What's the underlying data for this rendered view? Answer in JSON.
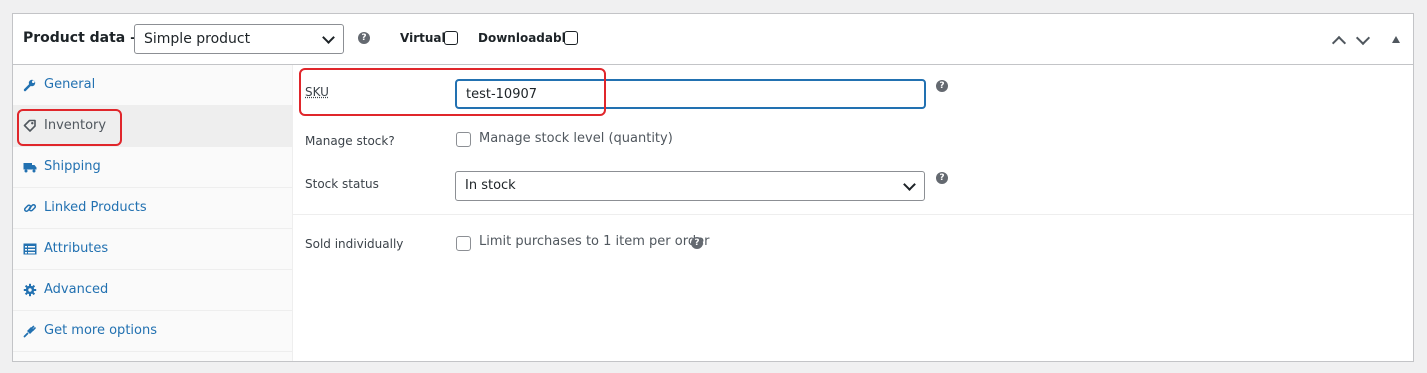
{
  "header": {
    "title": "Product data —",
    "product_type": "Simple product",
    "virtual_label": "Virtual:",
    "downloadable_label": "Downloadable:"
  },
  "sidebar": {
    "items": [
      {
        "label": "General",
        "icon": "wrench-icon"
      },
      {
        "label": "Inventory",
        "icon": "tag-icon",
        "active": true
      },
      {
        "label": "Shipping",
        "icon": "truck-icon"
      },
      {
        "label": "Linked Products",
        "icon": "link-icon"
      },
      {
        "label": "Attributes",
        "icon": "list-icon"
      },
      {
        "label": "Advanced",
        "icon": "gear-icon"
      },
      {
        "label": "Get more options",
        "icon": "plugin-icon"
      }
    ]
  },
  "inventory": {
    "sku_label": "SKU",
    "sku_value": "test-10907",
    "manage_stock_label": "Manage stock?",
    "manage_stock_text": "Manage stock level (quantity)",
    "stock_status_label": "Stock status",
    "stock_status_value": "In stock",
    "sold_individually_label": "Sold individually",
    "sold_individually_text": "Limit purchases to 1 item per order"
  },
  "colors": {
    "accent": "#2271b1",
    "highlight": "#e0262b"
  }
}
